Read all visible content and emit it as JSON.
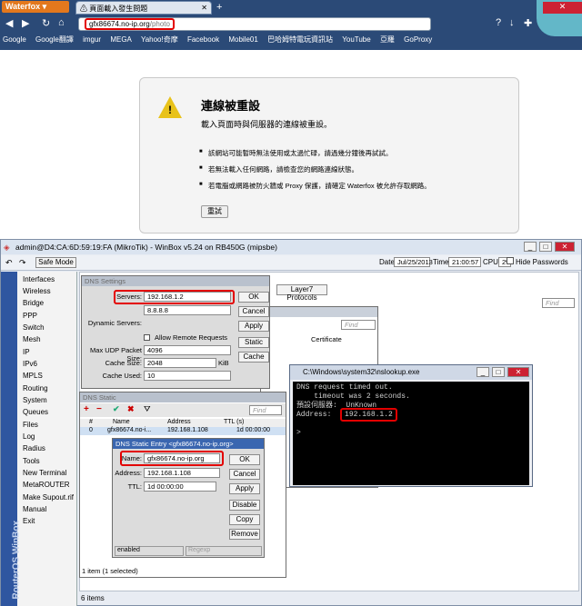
{
  "firefox": {
    "menu_label": "Waterfox",
    "tab_title": "頁面載入發生問題",
    "url_host": "gfx86674.no-ip.org",
    "url_path": "/photo",
    "bookmarks": [
      "Google",
      "Google翻譯",
      "imgur",
      "MEGA",
      "Yahoo!奇摩",
      "Facebook",
      "Mobile01",
      "巴哈姆特電玩資訊站",
      "YouTube",
      "亞羅",
      "GoProxy"
    ]
  },
  "error": {
    "title": "連線被重設",
    "subtitle": "載入頁面時與伺服器的連線被重設。",
    "bullets": [
      "該網站可能暫時無法使用或太過忙碌，請過幾分鐘後再試試。",
      "若無法載入任何網路，請檢查您的網路連線狀態。",
      "若電腦或網路被防火牆或 Proxy 保護，請確定 Waterfox 被允許存取網路。"
    ],
    "retry": "重試"
  },
  "winbox": {
    "title": "admin@D4:CA:6D:59:19:FA (MikroTik) - WinBox v5.24 on RB450G (mipsbe)",
    "safe_mode": "Safe Mode",
    "date_label": "Date:",
    "date": "Jul/25/2013",
    "time_label": "Time:",
    "time": "21:00:57",
    "cpu_label": "CPU:",
    "cpu": "2%",
    "hide_passwords": "Hide Passwords",
    "menu": [
      "Interfaces",
      "Wireless",
      "Bridge",
      "PPP",
      "Switch",
      "Mesh",
      "IP",
      "IPv6",
      "MPLS",
      "Routing",
      "System",
      "Queues",
      "Files",
      "Log",
      "Radius",
      "Tools",
      "New Terminal",
      "MetaROUTER",
      "Make Supout.rif",
      "Manual",
      "Exit"
    ],
    "vertical": "RouterOS WinBox",
    "status_items": "6 items",
    "layer7": "Layer7 Protocols",
    "find": "Find",
    "certificate": "Certificate"
  },
  "dns": {
    "title": "DNS Settings",
    "servers_label": "Servers:",
    "server1": "192.168.1.2",
    "server2": "8.8.8.8",
    "dynamic_label": "Dynamic Servers:",
    "allow_remote": "Allow Remote Requests",
    "udp_label": "Max UDP Packet Size:",
    "udp": "4096",
    "cache_size_label": "Cache Size:",
    "cache_size": "2048",
    "cache_unit": "KiB",
    "cache_used_label": "Cache Used:",
    "cache_used": "10",
    "ok": "OK",
    "cancel": "Cancel",
    "apply": "Apply",
    "static": "Static",
    "cache": "Cache"
  },
  "dnsstatic": {
    "title": "DNS Static",
    "find": "Find",
    "col_num": "#",
    "col_name": "Name",
    "col_addr": "Address",
    "col_ttl": "TTL (s)",
    "row_num": "0",
    "row_name": "gfx86674.no-i...",
    "row_addr": "192.168.1.108",
    "row_ttl": "1d 00:00:00",
    "status": "1 item (1 selected)"
  },
  "entry": {
    "title": "DNS Static Entry <gfx86674.no-ip.org>",
    "name_label": "Name:",
    "name": "gfx86674.no-ip.org",
    "addr_label": "Address:",
    "addr": "192.168.1.108",
    "ttl_label": "TTL:",
    "ttl": "1d 00:00:00",
    "ok": "OK",
    "cancel": "Cancel",
    "apply": "Apply",
    "disable": "Disable",
    "copy": "Copy",
    "remove": "Remove",
    "enabled": "enabled",
    "regexp": "Regexp"
  },
  "cmd": {
    "title": "C:\\Windows\\system32\\nslookup.exe",
    "line1": "DNS request timed out.",
    "line2": "    timeout was 2 seconds.",
    "line3": "預設伺服器:  UnKnown",
    "line4_label": "Address:  ",
    "line4_value": "192.168.1.2",
    "prompt": ">"
  }
}
